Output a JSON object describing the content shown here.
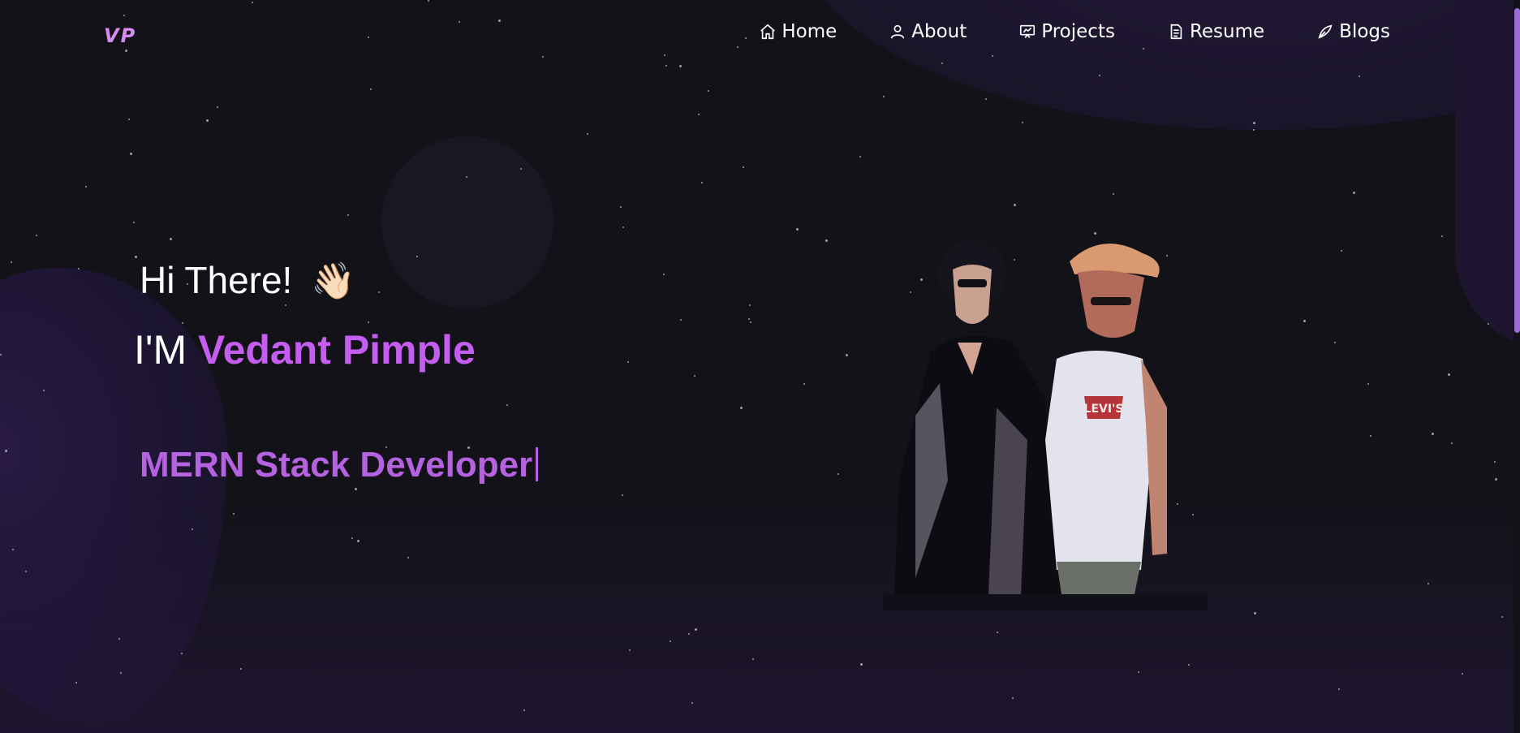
{
  "nav": {
    "logo": "VP",
    "items": [
      {
        "label": "Home",
        "icon": "home-icon"
      },
      {
        "label": "About",
        "icon": "user-icon"
      },
      {
        "label": "Projects",
        "icon": "projects-icon"
      },
      {
        "label": "Resume",
        "icon": "document-icon"
      },
      {
        "label": "Blogs",
        "icon": "pen-icon"
      }
    ]
  },
  "hero": {
    "greeting": "Hi There!",
    "wave": "👋🏻",
    "intro_prefix": "I'M ",
    "name": "Vedant Pimple",
    "role": "MERN Stack Developer"
  },
  "colors": {
    "background": "#131218",
    "accent": "#c55df0",
    "role_text": "#b562e0",
    "logo": "#d88cf2"
  }
}
